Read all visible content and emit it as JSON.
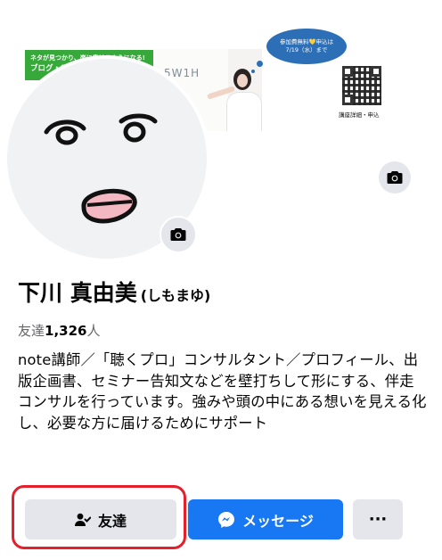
{
  "cover": {
    "banner_line1": "ネタが見つかり、楽に書けるようになる!",
    "banner_line2": "ブログ・SN",
    "board_text": "5W1H",
    "bubble_line1": "参加費無料💛申込は",
    "bubble_line2": "7/19（水）まで",
    "qr_label": "講座詳細・申込",
    "camera_icon": "camera-icon"
  },
  "profile": {
    "name": "下川 真由美",
    "nickname": "(しもまゆ)",
    "friends_label": "友達",
    "friends_count": "1,326",
    "friends_unit": "人",
    "bio": "note講師／「聴くプロ」コンサルタント／プロフィール、出版企画書、セミナー告知文などを壁打ちして形にする、伴走コンサルを行っています。強みや頭の中にある想いを見える化し、必要な方に届けるためにサポート"
  },
  "actions": {
    "friends_button": "友達",
    "message_button": "メッセージ",
    "more_button": "···"
  },
  "colors": {
    "primary": "#1877f2",
    "secondary_button": "#e4e6eb",
    "highlight": "#e3202b",
    "banner_green": "#37a93a",
    "bubble_blue": "#2d6fb6"
  }
}
